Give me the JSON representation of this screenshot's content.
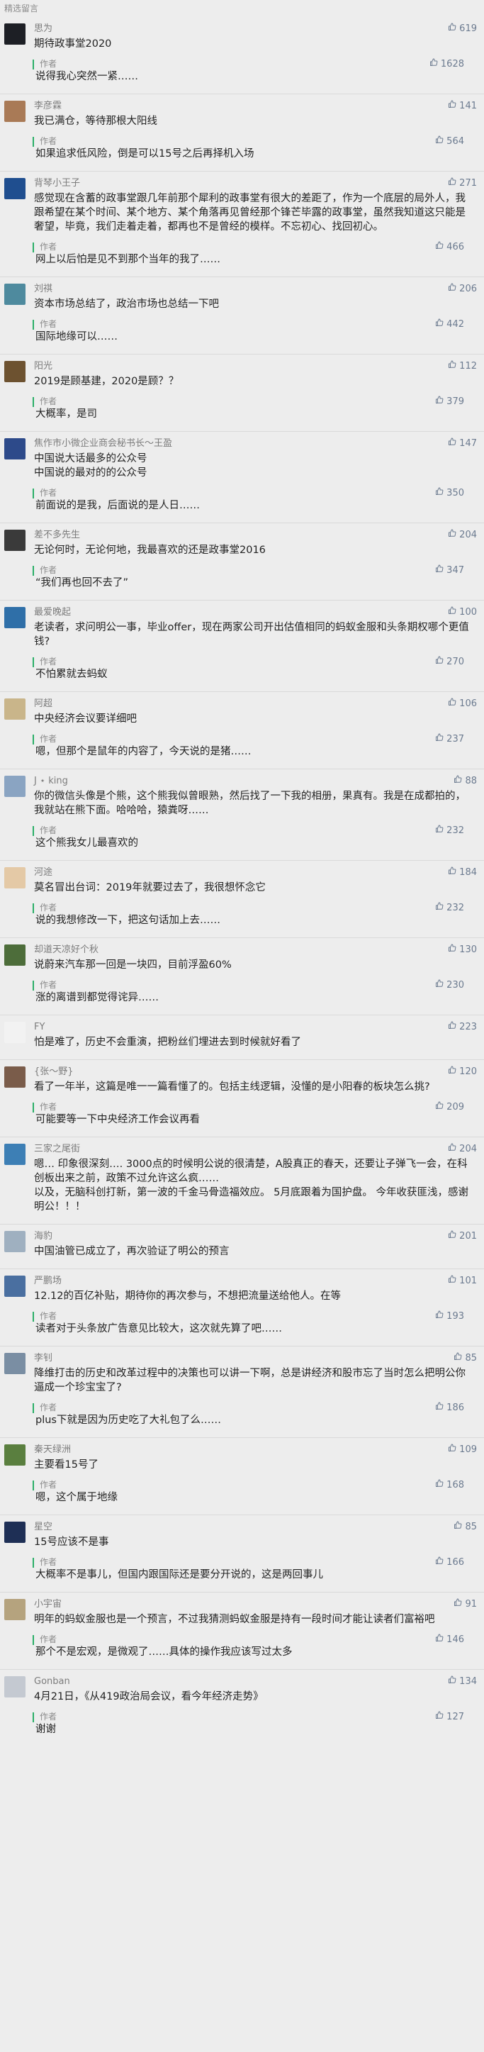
{
  "section_title": "精选留言",
  "colors": {
    "accent_green": "#2aae67",
    "like_blue": "#6b7a8f"
  },
  "comments": [
    {
      "name": "思为",
      "likes": "619",
      "content": "期待政事堂2020",
      "reply_author": "作者",
      "reply_likes": "1628",
      "reply_text": "说得我心突然一紧……",
      "avatar_color": "#1d1f25"
    },
    {
      "name": "李彦霖",
      "likes": "141",
      "content": "我已满仓，等待那根大阳线",
      "reply_author": "作者",
      "reply_likes": "564",
      "reply_text": "如果追求低风险，倒是可以15号之后再择机入场",
      "avatar_color": "#a97a56"
    },
    {
      "name": "背琴小王子",
      "likes": "271",
      "content": "感觉现在含蓄的政事堂跟几年前那个犀利的政事堂有很大的差距了，作为一个底层的局外人，我跟希望在某个时间、某个地方、某个角落再见曾经那个锋芒毕露的政事堂，虽然我知道这只能是奢望，毕竟，我们走着走着，都再也不是曾经的模样。不忘初心、找回初心。",
      "reply_author": "作者",
      "reply_likes": "466",
      "reply_text": "网上以后怕是见不到那个当年的我了……",
      "avatar_color": "#1f4e8f"
    },
    {
      "name": "刘祺",
      "likes": "206",
      "content": "资本市场总结了，政治市场也总结一下吧",
      "reply_author": "作者",
      "reply_likes": "442",
      "reply_text": "国际地缘可以……",
      "avatar_color": "#4e8a9e"
    },
    {
      "name": "阳光",
      "likes": "112",
      "content": "2019是顾基建，2020是顾？？",
      "reply_author": "作者",
      "reply_likes": "379",
      "reply_text": "大概率，是司",
      "avatar_color": "#6d5230"
    },
    {
      "name": "焦作市小微企业商会秘书长～王盈",
      "likes": "147",
      "content": "中国说大话最多的公众号\n中国说的最对的的公众号",
      "reply_author": "作者",
      "reply_likes": "350",
      "reply_text": "前面说的是我，后面说的是人日……",
      "avatar_color": "#2d4a8a"
    },
    {
      "name": "差不多先生",
      "likes": "204",
      "content": "无论何时，无论何地，我最喜欢的还是政事堂2016",
      "reply_author": "作者",
      "reply_likes": "347",
      "reply_text": "“我们再也回不去了”",
      "avatar_color": "#3a3a3a"
    },
    {
      "name": "最爱晚起",
      "likes": "100",
      "content": "老读者，求问明公一事，毕业offer，现在两家公司开出估值相同的蚂蚁金服和头条期权哪个更值钱?",
      "reply_author": "作者",
      "reply_likes": "270",
      "reply_text": "不怕累就去蚂蚁",
      "avatar_color": "#2f6fa8"
    },
    {
      "name": "阿超",
      "likes": "106",
      "content": "中央经济会议要详细吧",
      "reply_author": "作者",
      "reply_likes": "237",
      "reply_text": "嗯，但那个是鼠年的内容了，今天说的是猪……",
      "avatar_color": "#c9b58a"
    },
    {
      "name": "J ⋆ king",
      "likes": "88",
      "content": "你的微信头像是个熊，这个熊我似曾眼熟，然后找了一下我的相册，果真有。我是在成都拍的，我就站在熊下面。哈哈哈，猿粪呀……",
      "reply_author": "作者",
      "reply_likes": "232",
      "reply_text": "这个熊我女儿最喜欢的",
      "avatar_color": "#8aa4c2"
    },
    {
      "name": "河途",
      "likes": "184",
      "content": "莫名冒出台词：2019年就要过去了，我很想怀念它",
      "reply_author": "作者",
      "reply_likes": "232",
      "reply_text": "说的我想修改一下，把这句话加上去……",
      "avatar_color": "#e4c9a6"
    },
    {
      "name": "却道天凉好个秋",
      "likes": "130",
      "content": "说蔚来汽车那一回是一块四，目前浮盈60%",
      "reply_author": "作者",
      "reply_likes": "230",
      "reply_text": "涨的离谱到都觉得诧异……",
      "avatar_color": "#4d6d3a"
    },
    {
      "name": "FY",
      "likes": "223",
      "content": "怕是难了，历史不会重演，把粉丝们埋进去到时候就好看了",
      "reply_author": "",
      "reply_likes": "",
      "reply_text": "",
      "avatar_color": "#f2f2f2"
    },
    {
      "name": "{张〜野}",
      "likes": "120",
      "content": "看了一年半，这篇是唯一一篇看懂了的。包括主线逻辑，没懂的是小阳春的板块怎么挑?",
      "reply_author": "作者",
      "reply_likes": "209",
      "reply_text": "可能要等一下中央经济工作会议再看",
      "avatar_color": "#7a5c4a"
    },
    {
      "name": "三家之尾街",
      "likes": "204",
      "content": "嗯… 印象很深刻…. 3000点的时候明公说的很清楚，A股真正的春天，还要让子弹飞一会，在科创板出来之前，政策不过允许这么疯……\n以及，无脑科创打新，第一波的千金马骨造福效应。 5月底跟着为国护盘。 今年收获匪浅，感谢明公！！！",
      "reply_author": "",
      "reply_likes": "",
      "reply_text": "",
      "avatar_color": "#3d7fb5"
    },
    {
      "name": "海豹",
      "likes": "201",
      "content": "中国油管已成立了，再次验证了明公的预言",
      "reply_author": "",
      "reply_likes": "",
      "reply_text": "",
      "avatar_color": "#9fb0c0"
    },
    {
      "name": "严鹏场",
      "likes": "101",
      "content": "12.12的百亿补贴，期待你的再次参与，不想把流量送给他人。在等",
      "reply_author": "作者",
      "reply_likes": "193",
      "reply_text": "读者对于头条放广告意见比较大，这次就先算了吧……",
      "avatar_color": "#4a6fa0"
    },
    {
      "name": "李钊",
      "likes": "85",
      "content": "降维打击的历史和改革过程中的决策也可以讲一下啊，总是讲经济和股市忘了当时怎么把明公你逼成一个珍宝宝了?",
      "reply_author": "作者",
      "reply_likes": "186",
      "reply_text": "plus下就是因为历史吃了大礼包了么……",
      "avatar_color": "#7a8ea3"
    },
    {
      "name": "秦天绿洲",
      "likes": "109",
      "content": "主要看15号了",
      "reply_author": "作者",
      "reply_likes": "168",
      "reply_text": "嗯，这个属于地缘",
      "avatar_color": "#5a7f3f"
    },
    {
      "name": "星空",
      "likes": "85",
      "content": "15号应该不是事",
      "reply_author": "作者",
      "reply_likes": "166",
      "reply_text": "大概率不是事儿，但国内跟国际还是要分开说的，这是两回事儿",
      "avatar_color": "#1e2f55"
    },
    {
      "name": "小宇宙",
      "likes": "91",
      "content": "明年的蚂蚁金服也是一个预言，不过我猜测蚂蚁金服是持有一段时间才能让读者们富裕吧",
      "reply_author": "作者",
      "reply_likes": "146",
      "reply_text": "那个不是宏观，是微观了……具体的操作我应该写过太多",
      "avatar_color": "#b5a37e"
    },
    {
      "name": "Gonban",
      "likes": "134",
      "content": "4月21日，《从419政治局会议，看今年经济走势》",
      "reply_author": "作者",
      "reply_likes": "127",
      "reply_text": "谢谢",
      "avatar_color": "#c4c9d1"
    }
  ]
}
